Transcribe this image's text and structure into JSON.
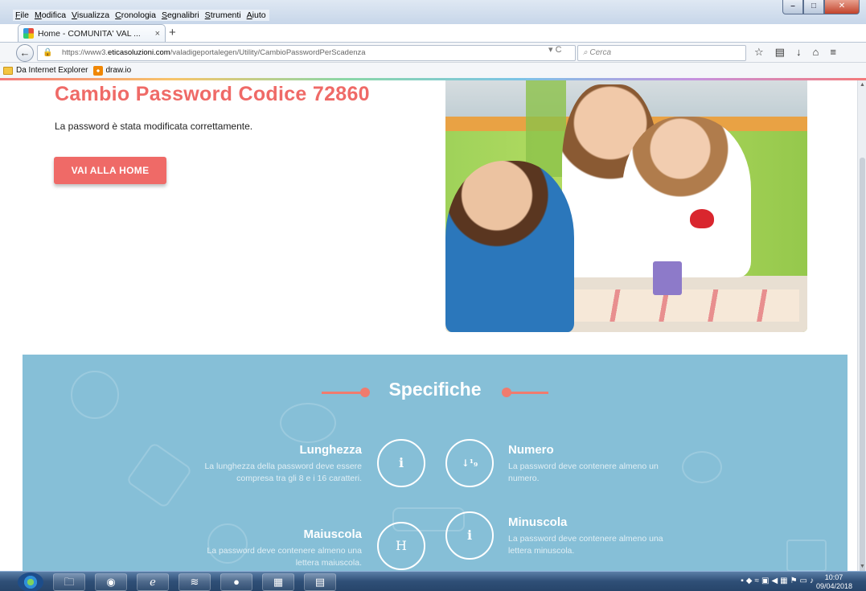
{
  "browser": {
    "menu": [
      "File",
      "Modifica",
      "Visualizza",
      "Cronologia",
      "Segnalibri",
      "Strumenti",
      "Aiuto"
    ],
    "tab_title": "Home - COMUNITA' VAL ...",
    "tab_close": "×",
    "new_tab": "+",
    "url_prefix": "https://www3.",
    "url_domain": "eticasoluzioni.com",
    "url_path": "/valadigeportalegen/Utility/CambioPasswordPerScadenza",
    "search_placeholder": "Cerca",
    "bookmarks": [
      "Da Internet Explorer",
      "draw.io"
    ]
  },
  "page": {
    "title": "Cambio Password Codice 72860",
    "message": "La password è stata modificata correttamente.",
    "home_button": "VAI ALLA HOME"
  },
  "specs": {
    "title": "Specifiche",
    "items": [
      {
        "title": "Lunghezza",
        "desc": "La lunghezza della password deve essere compresa tra gli 8 e i 16 caratteri.",
        "icon": "info-icon",
        "glyph": "i"
      },
      {
        "title": "Numero",
        "desc": "La password deve contenere almeno un numero.",
        "icon": "sort-numeric-icon",
        "glyph": "↓¹₉"
      },
      {
        "title": "Maiuscola",
        "desc": "La password deve contenere almeno una lettera maiuscola.",
        "icon": "uppercase-h-icon",
        "glyph": "H"
      },
      {
        "title": "Minuscola",
        "desc": "La password deve contenere almeno una lettera minuscola.",
        "icon": "info-icon",
        "glyph": "i"
      }
    ]
  },
  "taskbar": {
    "time": "10:07",
    "date": "09/04/2018"
  },
  "colors": {
    "accent": "#ef6a67",
    "spec_bg": "#86bfd7"
  }
}
